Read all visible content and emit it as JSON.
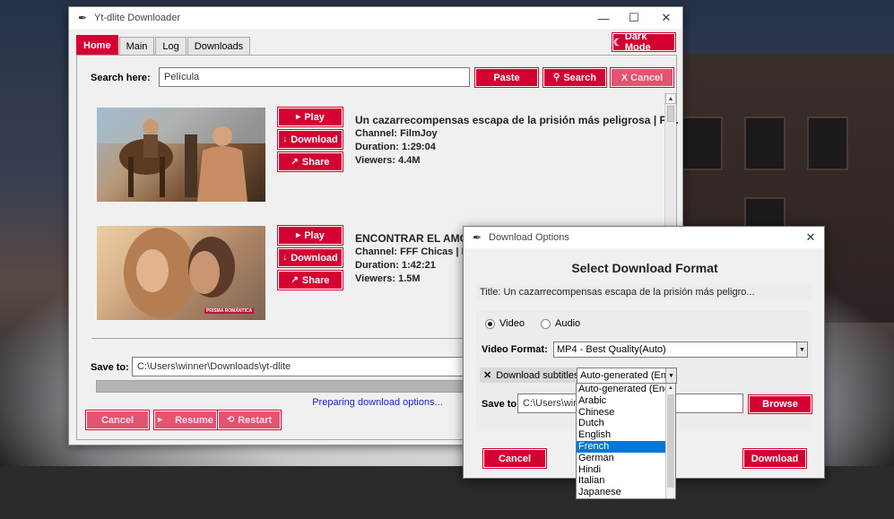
{
  "main_window": {
    "title": "Yt-dlite Downloader",
    "controls": {
      "minimize": "—",
      "maximize": "☐",
      "close": "✕"
    },
    "tabs": [
      {
        "label": "Home",
        "active": true
      },
      {
        "label": "Main",
        "active": false
      },
      {
        "label": "Log",
        "active": false
      },
      {
        "label": "Downloads",
        "active": false
      }
    ],
    "dark_mode_button": "Dark Mode",
    "search": {
      "label": "Search here:",
      "value": "Película",
      "paste": "Paste",
      "search": "Search",
      "cancel": "X Cancel"
    },
    "results": [
      {
        "title": "Un cazarrecompensas escapa de la prisión más peligrosa | Pel...",
        "channel": "Channel: FilmJoy",
        "duration": "Duration: 1:29:04",
        "viewers": "Viewers: 4.4M",
        "play": "Play",
        "download": "Download",
        "share": "Share"
      },
      {
        "title": "ENCONTRAR EL AMOR U",
        "channel": "Channel: FFF Chicas | Pelícu",
        "duration": "Duration: 1:42:21",
        "viewers": "Viewers: 1.5M",
        "play": "Play",
        "download": "Download",
        "share": "Share",
        "thumb_badge": "PRISMA ROMÁNTICA"
      }
    ],
    "save_to": {
      "label": "Save to:",
      "value": "C:\\Users\\winner\\Downloads\\yt-dlite"
    },
    "progress": 0,
    "status": "Preparing download options...",
    "bottom_buttons": {
      "cancel": "Cancel",
      "resume": "Resume",
      "restart": "Restart"
    }
  },
  "dialog": {
    "title": "Download Options",
    "close": "✕",
    "heading": "Select Download Format",
    "video_title": "Title: Un cazarrecompensas escapa de la prisión más peligro...",
    "radio_video": "Video",
    "radio_audio": "Audio",
    "selected_type": "Video",
    "format_label": "Video Format:",
    "format_value": "MP4 - Best Quality(Auto)",
    "subtitles_checkbox": "Download subtitles:",
    "subtitles_checked": true,
    "subtitles_value": "Auto-generated (Englis",
    "subtitle_options": [
      "Auto-generated (Englis",
      "Arabic",
      "Chinese",
      "Dutch",
      "English",
      "French",
      "German",
      "Hindi",
      "Italian",
      "Japanese"
    ],
    "subtitle_highlighted": "French",
    "save_label": "Save to:",
    "save_value": "C:\\Users\\winn",
    "browse": "Browse",
    "cancel": "Cancel",
    "download": "Download"
  },
  "colors": {
    "accent": "#d50032",
    "status_text": "#1a25c8",
    "selection": "#0078d7"
  }
}
